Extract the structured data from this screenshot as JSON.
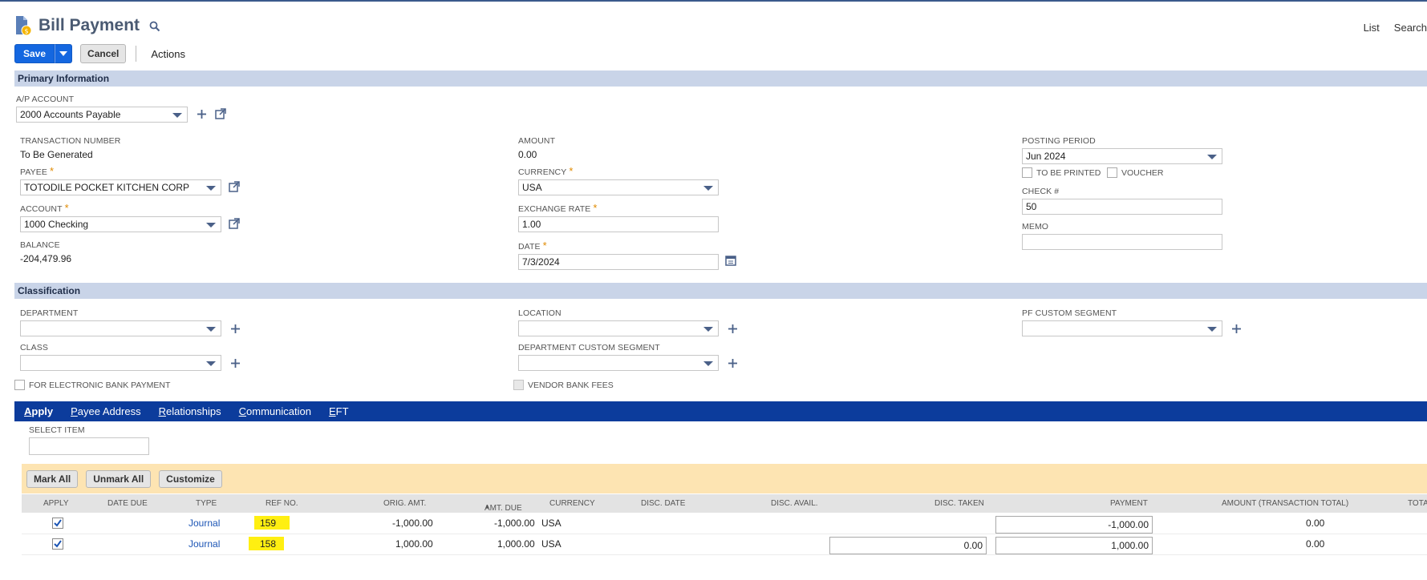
{
  "header": {
    "title": "Bill Payment",
    "links": [
      "List",
      "Search"
    ]
  },
  "toolbar": {
    "save_label": "Save",
    "cancel_label": "Cancel",
    "actions_label": "Actions"
  },
  "primary": {
    "section_title": "Primary Information",
    "ap_account": {
      "label": "A/P ACCOUNT",
      "value": "2000 Accounts Payable"
    },
    "transaction_number": {
      "label": "TRANSACTION NUMBER",
      "value": "To Be Generated"
    },
    "payee": {
      "label": "PAYEE",
      "value": "TOTODILE POCKET KITCHEN CORP"
    },
    "account": {
      "label": "ACCOUNT",
      "value": "1000 Checking"
    },
    "balance": {
      "label": "BALANCE",
      "value": "-204,479.96"
    },
    "amount": {
      "label": "AMOUNT",
      "value": "0.00"
    },
    "currency": {
      "label": "CURRENCY",
      "value": "USA"
    },
    "exchange_rate": {
      "label": "EXCHANGE RATE",
      "value": "1.00"
    },
    "date": {
      "label": "DATE",
      "value": "7/3/2024"
    },
    "posting_period": {
      "label": "POSTING PERIOD",
      "value": "Jun 2024"
    },
    "to_be_printed": "TO BE PRINTED",
    "voucher": "VOUCHER",
    "check_number": {
      "label": "CHECK #",
      "value": "50"
    },
    "memo": {
      "label": "MEMO",
      "value": ""
    }
  },
  "classification": {
    "section_title": "Classification",
    "department": {
      "label": "DEPARTMENT",
      "value": ""
    },
    "class": {
      "label": "CLASS",
      "value": ""
    },
    "for_electronic": "FOR ELECTRONIC BANK PAYMENT",
    "location": {
      "label": "LOCATION",
      "value": ""
    },
    "dept_custom_segment": {
      "label": "DEPARTMENT CUSTOM SEGMENT",
      "value": ""
    },
    "vendor_bank_fees": "VENDOR BANK FEES",
    "pf_custom_segment": {
      "label": "PF CUSTOM SEGMENT",
      "value": ""
    }
  },
  "tabs": [
    {
      "label": "Apply",
      "u": "A",
      "rest": "pply"
    },
    {
      "label": "Payee Address",
      "u": "P",
      "rest": "ayee Address"
    },
    {
      "label": "Relationships",
      "u": "R",
      "rest": "elationships"
    },
    {
      "label": "Communication",
      "u": "C",
      "rest": "ommunication"
    },
    {
      "label": "EFT",
      "u": "E",
      "rest": "FT"
    }
  ],
  "apply": {
    "select_item_label": "SELECT ITEM",
    "select_item_value": "",
    "mark_all": "Mark All",
    "unmark_all": "Unmark All",
    "customize": "Customize",
    "columns": {
      "apply": "APPLY",
      "date_due": "DATE DUE",
      "type": "TYPE",
      "ref_no": "REF NO.",
      "orig_amt": "ORIG. AMT.",
      "amt_due": "AMT. DUE",
      "currency": "CURRENCY",
      "disc_date": "DISC. DATE",
      "disc_avail": "DISC. AVAIL.",
      "disc_taken": "DISC. TAKEN",
      "payment": "PAYMENT",
      "amount_total": "AMOUNT (TRANSACTION TOTAL)",
      "total": "TOTA"
    },
    "rows": [
      {
        "type": "Journal",
        "ref": "159",
        "orig": "-1,000.00",
        "due": "-1,000.00",
        "currency": "USA",
        "disc_taken": "",
        "payment": "-1,000.00",
        "amount_total": "0.00"
      },
      {
        "type": "Journal",
        "ref": "158",
        "orig": "1,000.00",
        "due": "1,000.00",
        "currency": "USA",
        "disc_taken": "0.00",
        "payment": "1,000.00",
        "amount_total": "0.00"
      }
    ]
  },
  "colors": {
    "accent": "#1467e0",
    "section": "#c9d4e8",
    "tabs": "#0c3c9c",
    "apply_bar": "#fde4b2",
    "highlight": "#ffef11"
  }
}
